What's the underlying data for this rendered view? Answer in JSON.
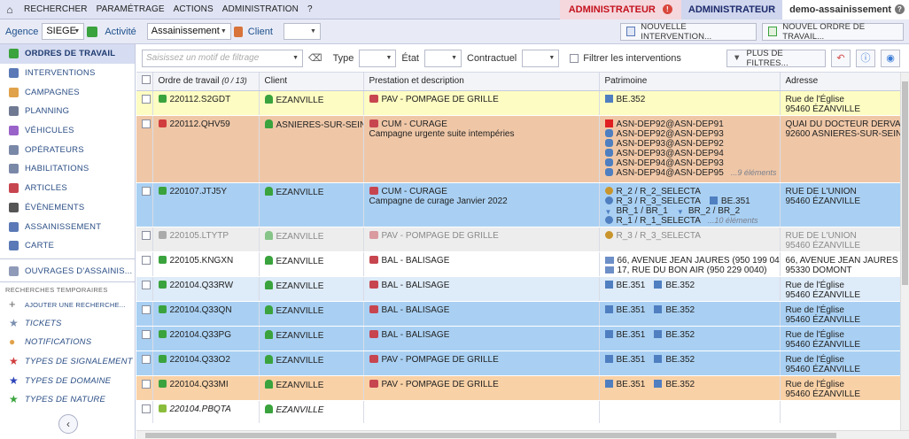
{
  "topbar": {
    "menu": [
      "RECHERCHER",
      "PARAMÉTRAGE",
      "ACTIONS",
      "ADMINISTRATION",
      "?"
    ],
    "role_warning": "ADMINISTRATEUR",
    "role": "ADMINISTRATEUR",
    "tenant": "demo-assainissement"
  },
  "filterbar": {
    "agency_label": "Agence",
    "agency_value": "SIEGE",
    "activity_label": "Activité",
    "activity_value": "Assainissement",
    "client_label": "Client",
    "client_value": "",
    "new_intervention": "NOUVELLE INTERVENTION...",
    "new_work_order": "NOUVEL ORDRE DE TRAVAIL..."
  },
  "sidebar": {
    "items": [
      {
        "label": "ORDRES DE TRAVAIL",
        "icon": "list-icon",
        "color": "#3aa33d",
        "active": true
      },
      {
        "label": "INTERVENTIONS",
        "icon": "list-icon",
        "color": "#5a79b6"
      },
      {
        "label": "CAMPAGNES",
        "icon": "clock-icon",
        "color": "#e0a24a"
      },
      {
        "label": "PLANNING",
        "icon": "calendar-icon",
        "color": "#6f7a92"
      },
      {
        "label": "VÉHICULES",
        "icon": "car-icon",
        "color": "#9a63c9"
      },
      {
        "label": "OPÉRATEURS",
        "icon": "operator-icon",
        "color": "#7a88a8"
      },
      {
        "label": "HABILITATIONS",
        "icon": "badge-icon",
        "color": "#7a88a8"
      },
      {
        "label": "ARTICLES",
        "icon": "tag-icon",
        "color": "#c7454f"
      },
      {
        "label": "ÉVÈNEMENTS",
        "icon": "chevron-right-icon",
        "color": "#555"
      },
      {
        "label": "ASSAINISSEMENT",
        "icon": "square-icon",
        "color": "#5a79b6"
      },
      {
        "label": "CARTE",
        "icon": "map-icon",
        "color": "#5a79b6"
      }
    ],
    "item_works": "OUVRAGES D'ASSAINIS...",
    "temp_heading": "RECHERCHES TEMPORAIRES",
    "add_search": "AJOUTER UNE RECHERCHE...",
    "temp_items": [
      {
        "label": "TICKETS",
        "icon": "star-icon",
        "color": "#7a8fb0"
      },
      {
        "label": "NOTIFICATIONS",
        "icon": "alert-icon",
        "color": "#e0a24a"
      },
      {
        "label": "TYPES DE SIGNALEMENT",
        "icon": "star-icon",
        "color": "#d13c3c"
      },
      {
        "label": "TYPES DE DOMAINE",
        "icon": "star-icon",
        "color": "#2c43b8"
      },
      {
        "label": "TYPES DE NATURE",
        "icon": "star-icon",
        "color": "#3aa33d"
      }
    ],
    "collapse": "‹"
  },
  "toolbar": {
    "search_placeholder": "Saisissez un motif de filtrage",
    "type_label": "Type",
    "state_label": "État",
    "contract_label": "Contractuel",
    "filter_interventions": "Filtrer les interventions",
    "more_filters": "PLUS DE FILTRES..."
  },
  "table": {
    "headers": [
      "Ordre de travail",
      "(0 / 13)",
      "Client",
      "Prestation et description",
      "Patrimoine",
      "Adresse"
    ],
    "rows": [
      {
        "bg": "#fdfcc2",
        "id": "220112.S2GDT",
        "client": "EZANVILLE",
        "prestation": "PAV - POMPAGE DE GRILLE",
        "desc": "",
        "patrimoine": [
          [
            "BE.352"
          ]
        ],
        "more": "",
        "address": [
          "Rue de l'Église",
          "95460 ÉZANVILLE"
        ],
        "status": "#3aa33d",
        "h": 28
      },
      {
        "bg": "#efc7a7",
        "id": "220112.QHV59",
        "client": "ASNIERES-SUR-SEINE",
        "prestation": "CUM - CURAGE",
        "desc": "Campagne urgente suite intempéries",
        "patrimoine": [
          [
            "ASN-DEP92@ASN-DEP91"
          ],
          [
            "ASN-DEP92@ASN-DEP93"
          ],
          [
            "ASN-DEP93@ASN-DEP92"
          ],
          [
            "ASN-DEP93@ASN-DEP94"
          ],
          [
            "ASN-DEP94@ASN-DEP93"
          ],
          [
            "ASN-DEP94@ASN-DEP95"
          ]
        ],
        "more": "...9 éléments",
        "address": [
          "QUAI DU DOCTEUR DERVAUX",
          "92600 ASNIERES-SUR-SEINE"
        ],
        "status": "#d13c3c",
        "h": 76
      },
      {
        "bg": "#a9d0f3",
        "id": "220107.JTJ5Y",
        "client": "EZANVILLE",
        "prestation": "CUM - CURAGE",
        "desc": "Campagne de curage Janvier 2022",
        "patrimoine": [
          [
            "R_2 / R_2_SELECTA"
          ],
          [
            "R_3 / R_3_SELECTA",
            "BE.351"
          ],
          [
            "BR_1 / BR_1",
            "BR_2 / BR_2"
          ],
          [
            "R_1 / R_1_SELECTA"
          ]
        ],
        "more": "...10 éléments",
        "address": [
          "RUE DE L'UNION",
          "95460 ÉZANVILLE"
        ],
        "status": "#3aa33d",
        "h": 50
      },
      {
        "bg": "#ededed",
        "id": "220105.LTYTP",
        "client": "EZANVILLE",
        "prestation": "PAV - POMPAGE DE GRILLE",
        "desc": "",
        "patrimoine": [
          [
            "R_3 / R_3_SELECTA"
          ]
        ],
        "more": "",
        "address": [
          "RUE DE L'UNION",
          "95460 ÉZANVILLE"
        ],
        "status": "#aaaaaa",
        "h": 28,
        "grey": true
      },
      {
        "bg": "#ffffff",
        "id": "220105.KNGXN",
        "client": "EZANVILLE",
        "prestation": "BAL - BALISAGE",
        "desc": "",
        "patrimoine": [
          [
            "66, AVENUE JEAN JAURES (950 199 0400)"
          ],
          [
            "17, RUE DU BON AIR (950 229 0040)"
          ]
        ],
        "more": "",
        "address": [
          "66, AVENUE JEAN JAURES",
          "95330 DOMONT"
        ],
        "status": "#3aa33d",
        "h": 28
      },
      {
        "bg": "#deebf8",
        "id": "220104.Q33RW",
        "client": "EZANVILLE",
        "prestation": "BAL - BALISAGE",
        "desc": "",
        "patrimoine": [
          [
            "BE.351",
            "BE.352"
          ]
        ],
        "more": "",
        "address": [
          "Rue de l'Église",
          "95460 ÉZANVILLE"
        ],
        "status": "#3aa33d",
        "h": 28
      },
      {
        "bg": "#a9d0f3",
        "id": "220104.Q33QN",
        "client": "EZANVILLE",
        "prestation": "BAL - BALISAGE",
        "desc": "",
        "patrimoine": [
          [
            "BE.351",
            "BE.352"
          ]
        ],
        "more": "",
        "address": [
          "Rue de l'Église",
          "95460 ÉZANVILLE"
        ],
        "status": "#3aa33d",
        "h": 28
      },
      {
        "bg": "#a9d0f3",
        "id": "220104.Q33PG",
        "client": "EZANVILLE",
        "prestation": "BAL - BALISAGE",
        "desc": "",
        "patrimoine": [
          [
            "BE.351",
            "BE.352"
          ]
        ],
        "more": "",
        "address": [
          "Rue de l'Église",
          "95460 ÉZANVILLE"
        ],
        "status": "#3aa33d",
        "h": 28
      },
      {
        "bg": "#a9d0f3",
        "id": "220104.Q33O2",
        "client": "EZANVILLE",
        "prestation": "PAV - POMPAGE DE GRILLE",
        "desc": "",
        "patrimoine": [
          [
            "BE.351",
            "BE.352"
          ]
        ],
        "more": "",
        "address": [
          "Rue de l'Église",
          "95460 ÉZANVILLE"
        ],
        "status": "#3aa33d",
        "h": 28
      },
      {
        "bg": "#f9d1a6",
        "id": "220104.Q33MI",
        "client": "EZANVILLE",
        "prestation": "PAV - POMPAGE DE GRILLE",
        "desc": "",
        "patrimoine": [
          [
            "BE.351",
            "BE.352"
          ]
        ],
        "more": "",
        "address": [
          "Rue de l'Église",
          "95460 ÉZANVILLE"
        ],
        "status": "#3aa33d",
        "h": 28
      },
      {
        "bg": "#ffffff",
        "id": "220104.PBQTA",
        "client": "EZANVILLE",
        "prestation": "",
        "desc": "",
        "patrimoine": [],
        "more": "",
        "address": [
          "",
          ""
        ],
        "status": "#8bbd3c",
        "h": 26,
        "italic": true
      }
    ]
  }
}
